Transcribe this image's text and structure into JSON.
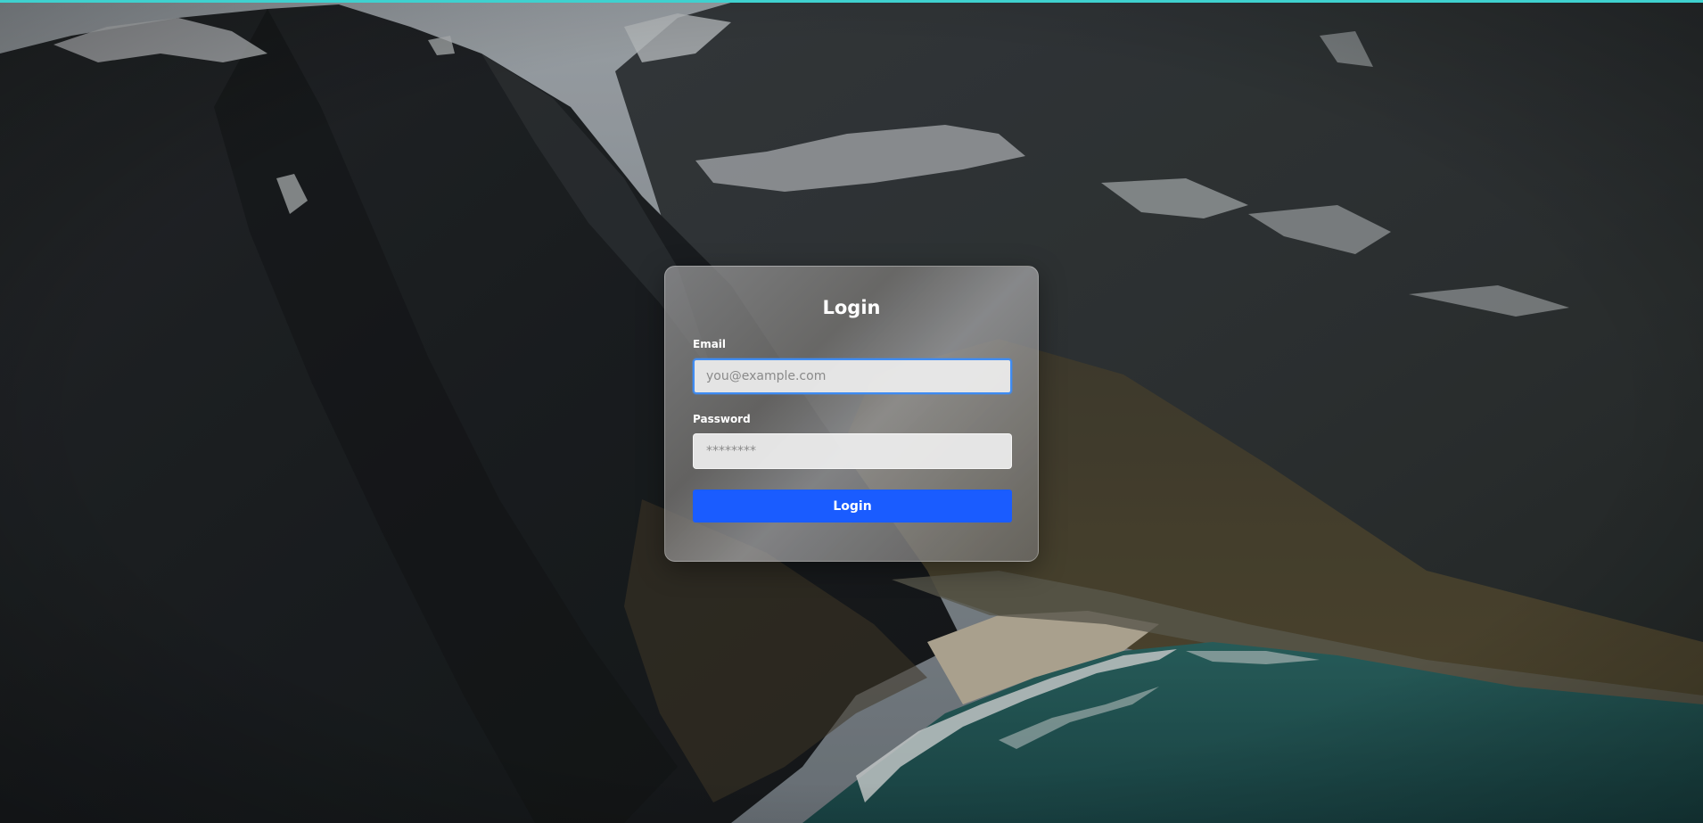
{
  "colors": {
    "accent": "#3fd1cf",
    "button": "#1a5cff",
    "focus_ring": "#3f8cf3"
  },
  "background": {
    "icon": "mountain-coastline-photo"
  },
  "login_form": {
    "title": "Login",
    "email": {
      "label": "Email",
      "value": "",
      "placeholder": "you@example.com"
    },
    "password": {
      "label": "Password",
      "value": "",
      "placeholder": "********"
    },
    "submit_label": "Login"
  }
}
